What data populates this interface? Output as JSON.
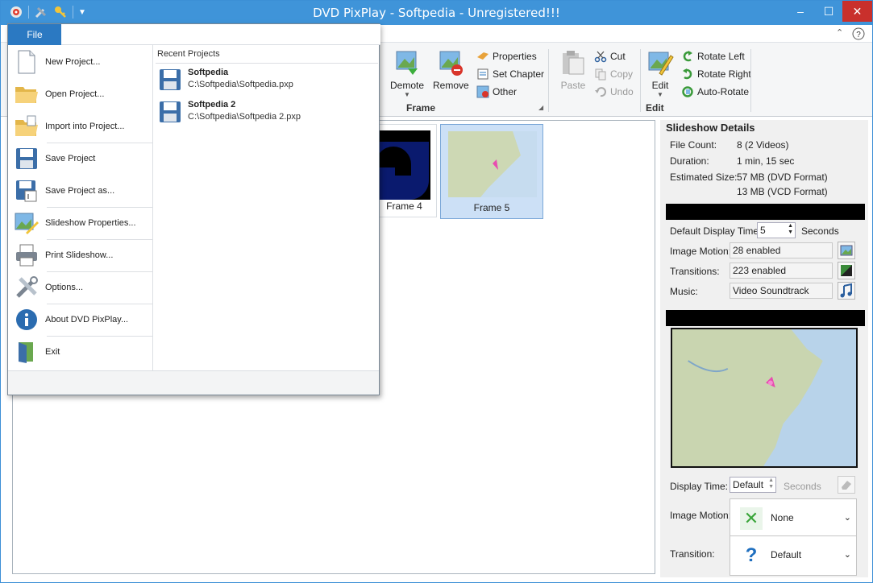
{
  "window": {
    "title": "DVD PixPlay - Softpedia - Unregistered!!!",
    "minimize": "–",
    "maximize": "☐",
    "close": "✕"
  },
  "ribbon": {
    "frame_group": {
      "label": "Frame",
      "demote": "Demote",
      "remove": "Remove",
      "properties": "Properties",
      "set_chapter": "Set Chapter",
      "other": "Other"
    },
    "edit_group": {
      "label": "Edit",
      "paste": "Paste",
      "cut": "Cut",
      "copy": "Copy",
      "undo": "Undo",
      "edit": "Edit",
      "rotate_left": "Rotate Left",
      "rotate_right": "Rotate Right",
      "auto_rotate": "Auto-Rotate"
    }
  },
  "frames": [
    {
      "label": "Frame 4"
    },
    {
      "label": "Frame 5"
    }
  ],
  "slideshow": {
    "heading": "Slideshow Details",
    "file_count_label": "File Count:",
    "file_count": "8  (2 Videos)",
    "duration_label": "Duration:",
    "duration": "1 min, 15 sec",
    "size_label": "Estimated Size:",
    "size_dvd": "57 MB (DVD Format)",
    "size_vcd": "13 MB (VCD Format)",
    "display_time_label": "Default Display Time:",
    "display_time": "5",
    "seconds": "Seconds",
    "image_motion_label": "Image Motion:",
    "image_motion": "28 enabled",
    "transitions_label": "Transitions:",
    "transitions": "223 enabled",
    "music_label": "Music:",
    "music": "Video Soundtrack"
  },
  "frame_props": {
    "display_time_label": "Display Time:",
    "display_time": "Default",
    "seconds": "Seconds",
    "image_motion_label": "Image Motion:",
    "image_motion": "None",
    "transition_label": "Transition:",
    "transition": "Default"
  },
  "file_menu": {
    "tab": "File",
    "items": [
      {
        "label": "New Project..."
      },
      {
        "label": "Open Project..."
      },
      {
        "label": "Import into Project..."
      },
      {
        "label": "Save Project"
      },
      {
        "label": "Save Project as..."
      },
      {
        "label": "Slideshow Properties..."
      },
      {
        "label": "Print Slideshow..."
      },
      {
        "label": "Options..."
      },
      {
        "label": "About DVD PixPlay..."
      },
      {
        "label": "Exit"
      }
    ],
    "recent_title": "Recent Projects",
    "recent": [
      {
        "name": "Softpedia",
        "path": "C:\\Softpedia\\Softpedia.pxp"
      },
      {
        "name": "Softpedia 2",
        "path": "C:\\Softpedia\\Softpedia 2.pxp"
      }
    ]
  },
  "colors": {
    "titlebar": "#3f94d9",
    "file_tab": "#2b79c2",
    "selection": "#cce0f6"
  }
}
